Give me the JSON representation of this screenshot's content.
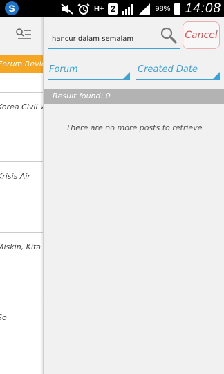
{
  "status_bar": {
    "battery_percent": "98%",
    "time": "14:08",
    "network_type": "H+",
    "sim_slot": "2",
    "icons": [
      "app-icon",
      "mute-icon",
      "alarm-icon",
      "network-icon",
      "sim-icon",
      "signal-icon",
      "signal-icon",
      "battery-icon"
    ]
  },
  "background_list": {
    "tab_label": "Forum Review",
    "items": [
      "Korea Civil War",
      "Krisis Air",
      "Miskin, Kita",
      "So"
    ]
  },
  "search": {
    "query": "hancur dalam semalam",
    "cancel_label": "Cancel"
  },
  "filters": {
    "forum_label": "Forum",
    "date_label": "Created Date"
  },
  "results": {
    "count_text": "Result found: 0",
    "empty_message": "There are no more posts to retrieve"
  },
  "colors": {
    "accent": "#3aa3d8",
    "tab_orange": "#f5a623",
    "cancel_red": "#d9534f",
    "result_bar_gray": "#b3b3b3"
  }
}
